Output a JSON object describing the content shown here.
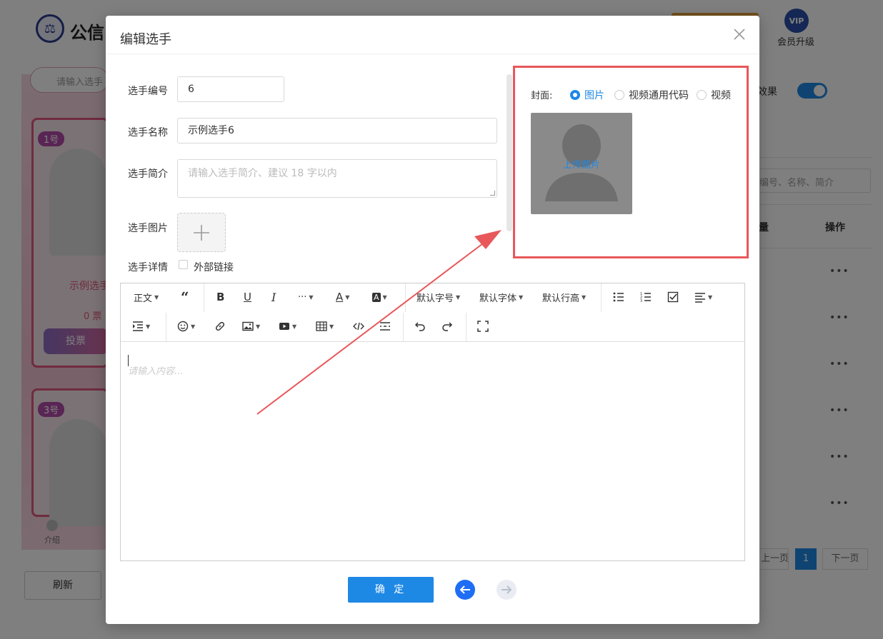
{
  "background": {
    "brand": "公信",
    "vip_badge": "VIP",
    "vip_label": "会员升级",
    "search_placeholder": "请输入选手",
    "cards": [
      {
        "tag": "1号",
        "name": "示例选手",
        "votes": "0 票",
        "vote_button": "投票"
      },
      {
        "tag": "3号"
      }
    ],
    "intro_label": "介绍",
    "refresh_button": "刷新",
    "effect_label": "效果",
    "search2_placeholder": "编号、名称、简介",
    "col_count": "量",
    "col_action": "操作",
    "row_menu": "•••",
    "pager": {
      "prev": "上一页",
      "current": "1",
      "next": "下一页"
    }
  },
  "modal": {
    "title": "编辑选手",
    "fields": {
      "number_label": "选手编号",
      "number_value": "6",
      "name_label": "选手名称",
      "name_value": "示例选手6",
      "intro_label": "选手简介",
      "intro_placeholder": "请输入选手简介、建议 18 字以内",
      "image_label": "选手图片",
      "detail_label": "选手详情",
      "external_link_label": "外部链接"
    },
    "cover": {
      "label": "封面:",
      "options": [
        "图片",
        "视频通用代码",
        "视频"
      ],
      "selected": "图片",
      "upload_text": "上传图片"
    },
    "editor": {
      "toolbar": {
        "paragraph": "正文",
        "more": "···",
        "font_size": "默认字号",
        "font_family": "默认字体",
        "line_height": "默认行高"
      },
      "placeholder": "请输入内容..."
    },
    "confirm_button": "确 定"
  },
  "colors": {
    "primary": "#1e88e5",
    "highlight": "#e8575a"
  }
}
